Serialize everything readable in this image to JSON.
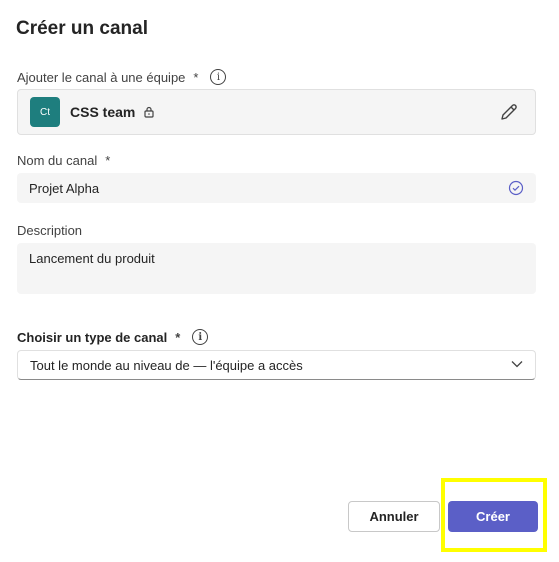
{
  "dialog": {
    "title": "Créer un canal"
  },
  "team_field": {
    "label": "Ajouter le canal à une équipe",
    "required_mark": "*",
    "team_avatar": "Ct",
    "team_name": "CSS team"
  },
  "name_field": {
    "label": "Nom du canal",
    "required_mark": "*",
    "value": "Projet Alpha"
  },
  "description_field": {
    "label": "Description",
    "value": "Lancement du produit"
  },
  "channel_type": {
    "label": "Choisir un type de canal",
    "required_mark": "*",
    "selected": "Tout le monde au niveau de — l'équipe a accès"
  },
  "buttons": {
    "cancel": "Annuler",
    "create": "Créer"
  },
  "colors": {
    "primary": "#5b5fc7",
    "team_avatar_bg": "#1e7e7e",
    "highlight": "#ffff00"
  },
  "icons": [
    "info-icon",
    "lock-icon",
    "edit-icon",
    "check-circle-icon",
    "chevron-down-icon"
  ]
}
